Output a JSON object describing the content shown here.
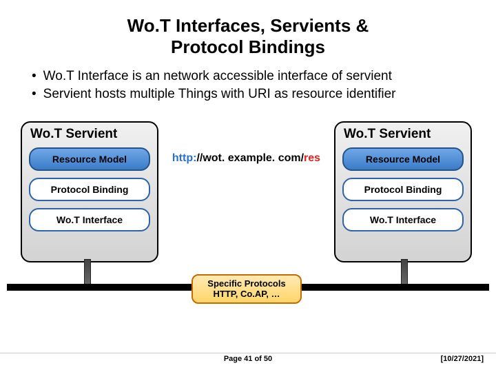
{
  "title_line1": "Wo.T Interfaces, Servients &",
  "title_line2": "Protocol Bindings",
  "bullets": [
    "Wo.T Interface is an network accessible interface of servient",
    "Servient hosts multiple Things with URI as resource identifier"
  ],
  "servient_title": "Wo.T Servient",
  "pill_resource": "Resource Model",
  "pill_binding": "Protocol Binding",
  "pill_interface": "Wo.T Interface",
  "uri": {
    "scheme": "http:",
    "rest": "//wot. example. com/",
    "res": "res"
  },
  "protocols_line1": "Specific Protocols",
  "protocols_line2": "HTTP, Co.AP, …",
  "page": "Page 41 of 50",
  "date": "[10/27/2021]"
}
